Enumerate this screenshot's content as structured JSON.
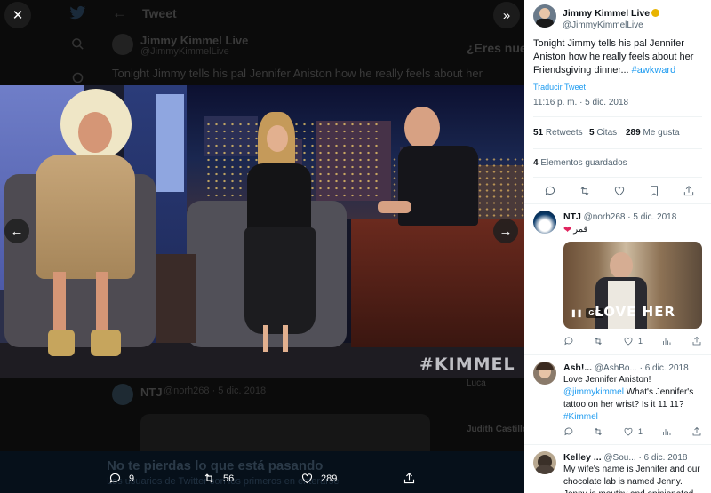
{
  "background": {
    "header_title": "Tweet",
    "author_name": "Jimmy Kimmel Live",
    "author_handle": "@JimmyKimmelLive",
    "tweet_text": "Tonight Jimmy tells his pal Jennifer Aniston how he really feels about her",
    "side_prompt": "¿Eres nuev",
    "reply_author": "NTJ",
    "reply_meta": "@norh268 · 5 dic. 2018",
    "trend_1": "Luca",
    "trend_2": "Judith Castillo",
    "banner_title": "No te pierdas lo que está pasando",
    "banner_sub": "Los usuarios de Twitter son los primeros en enterarse"
  },
  "viewer": {
    "watermark": "#KIMMEL",
    "actions": {
      "replies": "9",
      "retweets": "56",
      "likes": "289"
    }
  },
  "tweet": {
    "author_name": "Jimmy Kimmel Live",
    "author_handle": "@JimmyKimmelLive",
    "text": "Tonight Jimmy tells his pal Jennifer Aniston how he really feels about her Friendsgiving dinner... ",
    "hashtag": "#awkward",
    "translate_label": "Traducir Tweet",
    "timestamp": "11:16 p. m. · 5 dic. 2018",
    "retweets_count": "51",
    "retweets_label": "Retweets",
    "quotes_count": "5",
    "quotes_label": "Citas",
    "likes_count": "289",
    "likes_label": "Me gusta",
    "bookmarks_count": "4",
    "bookmarks_label": "Elementos guardados"
  },
  "replies": [
    {
      "name": "NTJ",
      "meta": "@norh268 · 5 dic. 2018",
      "text": "قمر",
      "gif_badge": "GIF",
      "gif_text": "LOVE HER",
      "likes": "1"
    },
    {
      "name": "Ash!...",
      "meta": "@AshBo... · 6 dic. 2018",
      "text_1": "Love Jennifer Aniston!",
      "mention": "@jimmykimmel",
      "text_2": " What's Jennifer's tattoo on her wrist? Is it 11 11?",
      "hashtag": "#Kimmel",
      "likes": "1"
    },
    {
      "name": "Kelley ...",
      "meta": "@Sou... · 6 dic. 2018",
      "text": "My wife's name is Jennifer and our chocolate lab is named Jenny. Jenny is mouthy and opinionated just like"
    }
  ],
  "colors": {
    "accent": "#1d9bf0",
    "verified": "#e8b400",
    "heart": "#e0245e"
  }
}
